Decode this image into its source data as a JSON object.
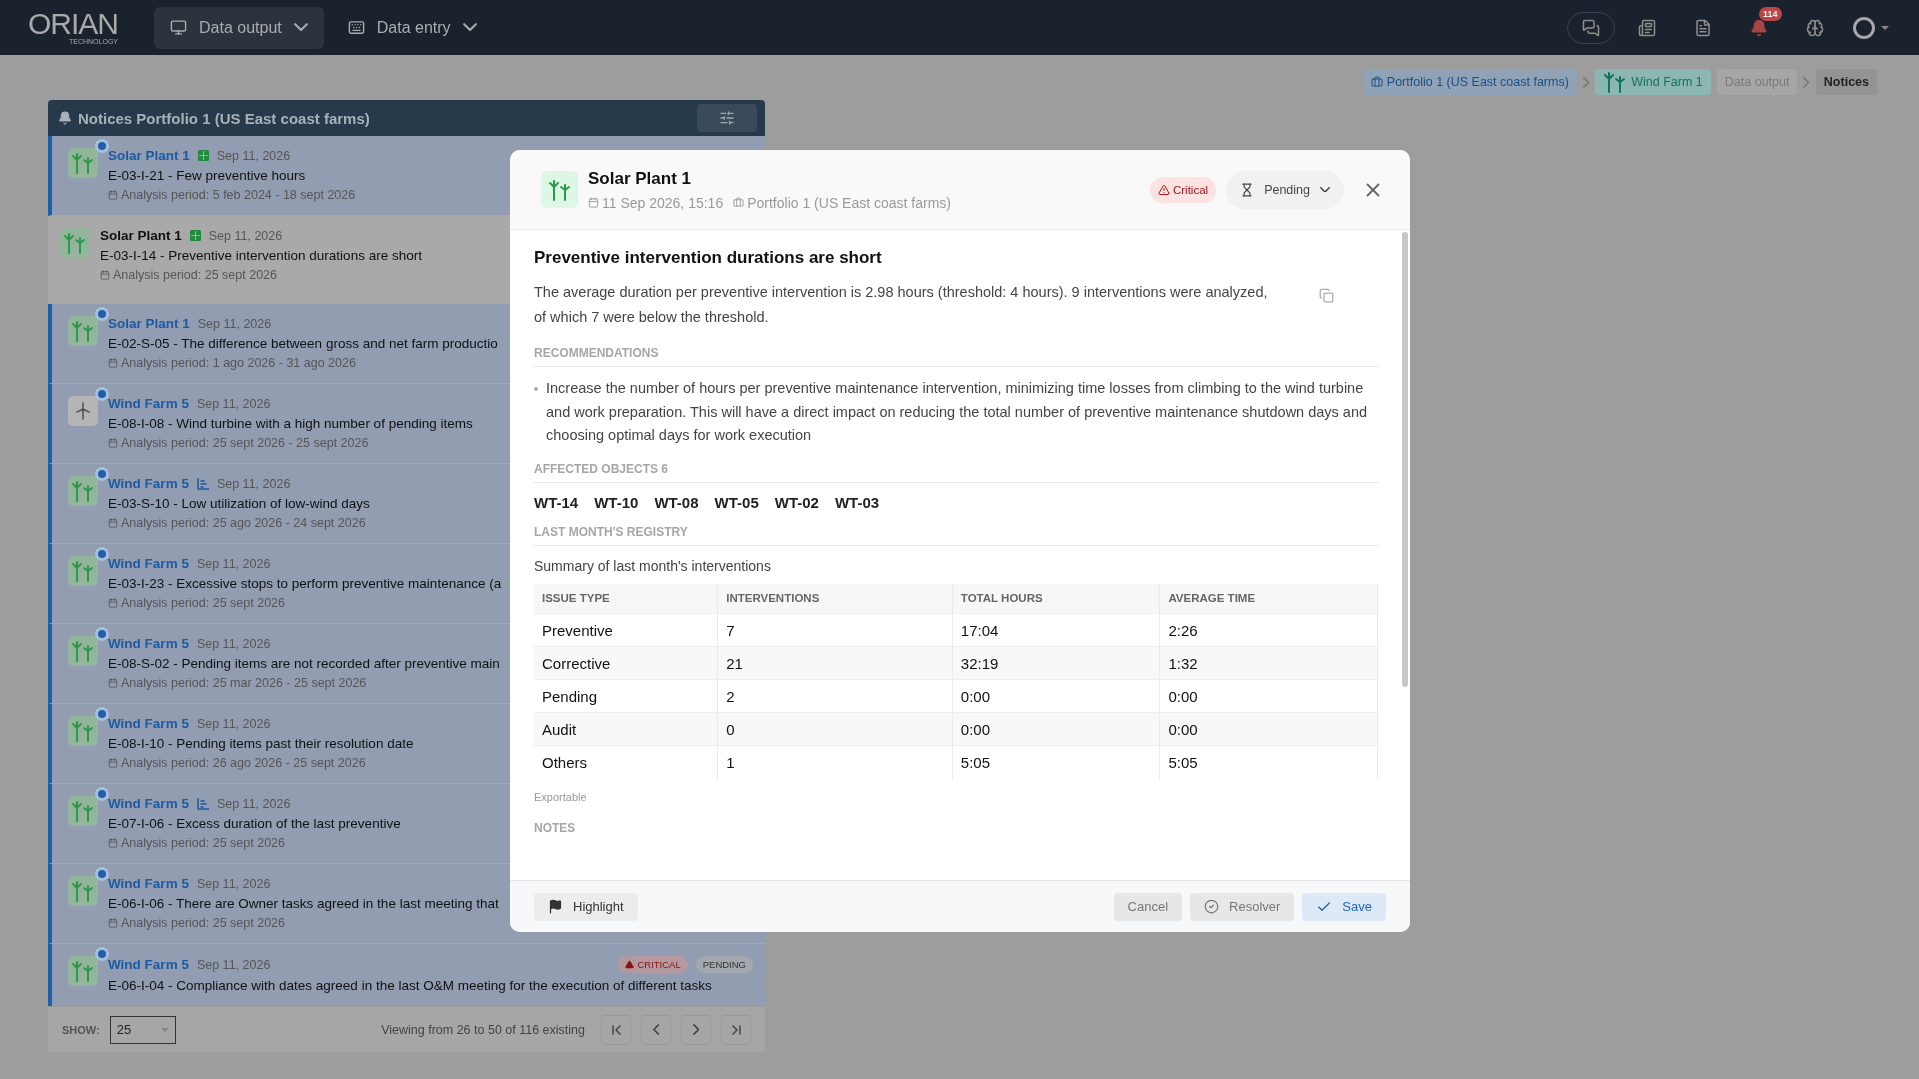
{
  "topbar": {
    "logo": "ORIAN",
    "logo_sub": "TECHNOLOGY",
    "menus": [
      {
        "label": "Data output",
        "selected": true
      },
      {
        "label": "Data entry",
        "selected": false
      }
    ],
    "notification_count": "114"
  },
  "breadcrumb": [
    {
      "label": "Portfolio 1 (US East coast farms)",
      "kind": "portfolio"
    },
    {
      "label": "Wind Farm 1",
      "kind": "farm"
    },
    {
      "label": "Data output",
      "kind": "plain"
    },
    {
      "label": "Notices",
      "kind": "current"
    }
  ],
  "panel": {
    "title": "Notices Portfolio 1 (US East coast farms)",
    "items": [
      {
        "kind": "farm",
        "unread": true,
        "selected": false,
        "site": "Solar Plant 1",
        "tag": {
          "kind": "grid"
        },
        "date": "Sep 11, 2026",
        "title": "E-03-I-21 - Few preventive hours",
        "period": "Analysis period: 5 feb 2024 - 18 sept 2026"
      },
      {
        "kind": "farm",
        "unread": false,
        "selected": true,
        "site": "Solar Plant 1",
        "tag": {
          "kind": "grid"
        },
        "date": "Sep 11, 2026",
        "title": "E-03-I-14 - Preventive intervention durations are short",
        "period": "Analysis period: 25 sept 2026"
      },
      {
        "kind": "farm",
        "unread": true,
        "selected": false,
        "site": "Solar Plant 1",
        "date": "Sep 11, 2026",
        "title": "E-02-S-05 - The difference between gross and net farm productio",
        "period": "Analysis period: 1 ago 2026 - 31 ago 2026"
      },
      {
        "kind": "turbine",
        "unread": true,
        "selected": false,
        "site": "Wind Farm 5",
        "date": "Sep 11, 2026",
        "title": "E-08-I-08 - Wind turbine with a high number of pending items",
        "period": "Analysis period: 25 sept 2026 - 25 sept 2026"
      },
      {
        "kind": "farm",
        "unread": true,
        "selected": false,
        "site": "Wind Farm 5",
        "tag": {
          "kind": "chart"
        },
        "date": "Sep 11, 2026",
        "title": "E-03-S-10 - Low utilization of low-wind days",
        "period": "Analysis period: 25 ago 2026 - 24 sept 2026"
      },
      {
        "kind": "farm",
        "unread": true,
        "selected": false,
        "site": "Wind Farm 5",
        "date": "Sep 11, 2026",
        "title": "E-03-I-23 - Excessive stops to perform preventive maintenance (a",
        "period": "Analysis period: 25 sept 2026"
      },
      {
        "kind": "farm",
        "unread": true,
        "selected": false,
        "site": "Wind Farm 5",
        "date": "Sep 11, 2026",
        "title": "E-08-S-02 - Pending items are not recorded after preventive main",
        "period": "Analysis period: 25 mar 2026 - 25 sept 2026"
      },
      {
        "kind": "farm",
        "unread": true,
        "selected": false,
        "site": "Wind Farm 5",
        "date": "Sep 11, 2026",
        "title": "E-08-I-10 - Pending items past their resolution date",
        "period": "Analysis period: 26 ago 2026 - 25 sept 2026"
      },
      {
        "kind": "farm",
        "unread": true,
        "selected": false,
        "site": "Wind Farm 5",
        "tag": {
          "kind": "chart"
        },
        "date": "Sep 11, 2026",
        "title": "E-07-I-06 - Excess duration of the last preventive",
        "period": "Analysis period: 25 sept 2026"
      },
      {
        "kind": "farm",
        "unread": true,
        "selected": false,
        "site": "Wind Farm 5",
        "date": "Sep 11, 2026",
        "title": "E-06-I-06 - There are Owner tasks agreed in the last meeting that",
        "period": "Analysis period: 25 sept 2026"
      },
      {
        "kind": "farm",
        "unread": true,
        "selected": false,
        "site": "Wind Farm 5",
        "date": "Sep 11, 2026",
        "title": "E-06-I-04 - Compliance with dates agreed in the last O&M meeting for the execution of different tasks",
        "badges": [
          {
            "label": "CRITICAL",
            "kind": "critical"
          },
          {
            "label": "PENDING",
            "kind": "pending"
          }
        ]
      }
    ],
    "show_label": "SHOW:",
    "page_size": "25",
    "viewing": "Viewing from 26 to 50 of 116 existing"
  },
  "modal": {
    "site": "Solar Plant 1",
    "date": "11 Sep 2026, 15:16",
    "portfolio": "Portfolio 1 (US East coast farms)",
    "severity": {
      "label": "Critical",
      "kind": "critical"
    },
    "status": "Pending",
    "title": "Preventive intervention durations are short",
    "description": "The average duration per preventive intervention is 2.98 hours (threshold: 4 hours). 9 interventions were analyzed, of which 7 were below the threshold.",
    "recommendations_heading": "RECOMMENDATIONS",
    "recommendations": [
      "Increase the number of hours per preventive maintenance intervention, minimizing time losses from climbing to the wind turbine and work preparation. This will have a direct impact on reducing the total number of preventive maintenance shutdown days and choosing optimal days for work execution"
    ],
    "affected_heading": "AFFECTED OBJECTS",
    "affected_count": "6",
    "objects": [
      "WT-14",
      "WT-10",
      "WT-08",
      "WT-05",
      "WT-02",
      "WT-03"
    ],
    "registry_heading": "LAST MONTH'S REGISTRY",
    "summary": "Summary of last month's interventions",
    "table": {
      "columns": [
        "ISSUE TYPE",
        "INTERVENTIONS",
        "TOTAL HOURS",
        "AVERAGE TIME"
      ],
      "rows": [
        [
          "Preventive",
          "7",
          "17:04",
          "2:26"
        ],
        [
          "Corrective",
          "21",
          "32:19",
          "1:32"
        ],
        [
          "Pending",
          "2",
          "0:00",
          "0:00"
        ],
        [
          "Audit",
          "0",
          "0:00",
          "0:00"
        ],
        [
          "Others",
          "1",
          "5:05",
          "5:05"
        ]
      ]
    },
    "exportable": "Exportable",
    "notes_heading": "NOTES",
    "buttons": [
      {
        "label": "Highlight",
        "kind": "highlight"
      },
      {
        "label": "Cancel",
        "kind": "cancel"
      },
      {
        "label": "Resolver",
        "kind": "resolve"
      },
      {
        "label": "Save",
        "kind": "save"
      }
    ]
  }
}
